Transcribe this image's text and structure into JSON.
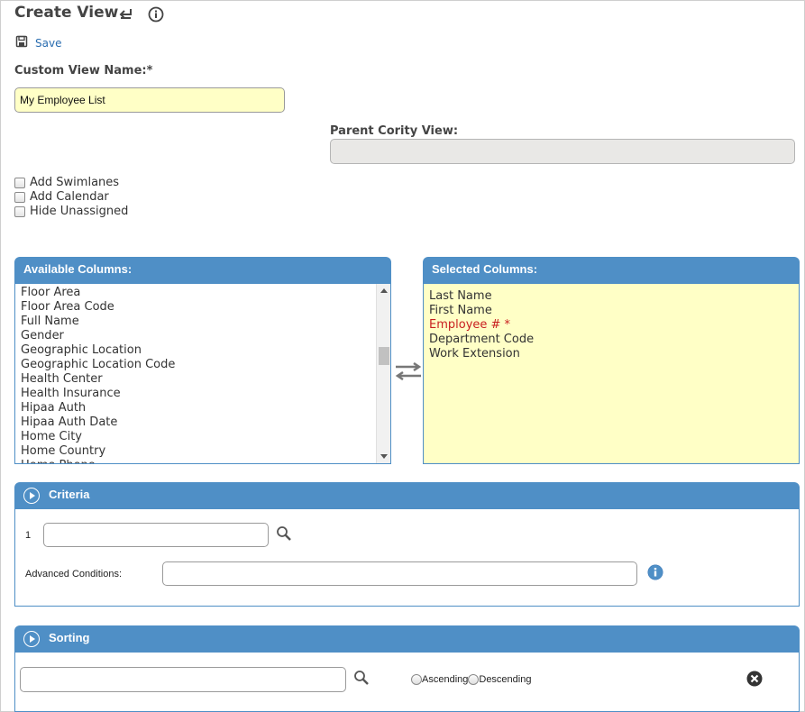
{
  "header": {
    "title": "Create View",
    "back_icon": "return-arrow-icon",
    "info_icon": "info-circle-icon"
  },
  "toolbar": {
    "save_label": "Save",
    "save_icon": "floppy-disk-icon"
  },
  "form": {
    "custom_view_name_label": "Custom View Name:*",
    "custom_view_name_value": "My Employee List",
    "parent_view_label": "Parent Cority View:",
    "parent_view_value": ""
  },
  "options": [
    {
      "label": "Add Swimlanes",
      "checked": false
    },
    {
      "label": "Add Calendar",
      "checked": false
    },
    {
      "label": "Hide Unassigned",
      "checked": false
    }
  ],
  "available_columns": {
    "title": "Available Columns:",
    "items": [
      "Floor Area",
      "Floor Area Code",
      "Full Name",
      "Gender",
      "Geographic Location",
      "Geographic Location Code",
      "Health Center",
      "Health Insurance",
      "Hipaa Auth",
      "Hipaa Auth Date",
      "Home City",
      "Home Country",
      "Home Phone"
    ]
  },
  "swap_icon": "swap-arrows-icon",
  "selected_columns": {
    "title": "Selected Columns:",
    "items": [
      {
        "label": "Last Name",
        "required": false
      },
      {
        "label": "First Name",
        "required": false
      },
      {
        "label": "Employee # *",
        "required": true
      },
      {
        "label": "Department Code",
        "required": false
      },
      {
        "label": "Work Extension",
        "required": false
      }
    ]
  },
  "criteria": {
    "title": "Criteria",
    "row_number": "1",
    "row_value": "",
    "search_icon": "magnifier-icon",
    "advanced_label": "Advanced Conditions:",
    "advanced_value": "",
    "advanced_info_icon": "info-circle-icon"
  },
  "sorting": {
    "title": "Sorting",
    "field_value": "",
    "search_icon": "magnifier-icon",
    "ascending_label": "Ascending",
    "descending_label": "Descending",
    "remove_icon": "close-circle-icon"
  },
  "colors": {
    "accent": "#4f8fc6",
    "required": "#c81f1f",
    "highlight": "#ffffc6",
    "link": "#2a6db0"
  }
}
